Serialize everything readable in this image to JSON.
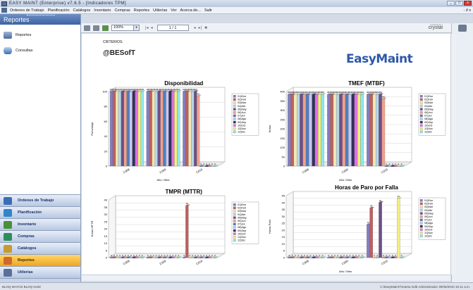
{
  "window": {
    "title": "EASY  MAINT (Enterprise) v7.6.5 - [Indicadores TPM]",
    "controls": [
      "_",
      "□",
      "x"
    ]
  },
  "menu": [
    "Ordenes de Trabajo",
    "Planificación",
    "Catálogos",
    "Inventario",
    "Compras",
    "Reportes",
    "Utilerías",
    "Ver",
    "Acerca de...",
    "Salir"
  ],
  "menu_right": "- ∂ x",
  "sidebar": {
    "header": "Reportes",
    "items": [
      {
        "label": "Reportes",
        "icon": "reports-icon"
      },
      {
        "label": "Consultas",
        "icon": "database-icon"
      }
    ],
    "nav": [
      {
        "label": "Ordenes de Trabajo",
        "icon": "work-orders-icon",
        "color": "#3b6db5"
      },
      {
        "label": "Planificación",
        "icon": "planning-icon",
        "color": "#2f86c9"
      },
      {
        "label": "Inventario",
        "icon": "inventory-icon",
        "color": "#4a8f3c"
      },
      {
        "label": "Compras",
        "icon": "cart-icon",
        "color": "#2c8e5f"
      },
      {
        "label": "Catálogos",
        "icon": "catalog-icon",
        "color": "#c99a2e"
      },
      {
        "label": "Reportes",
        "icon": "reports-icon",
        "color": "#d06a2c"
      },
      {
        "label": "Utilerías",
        "icon": "utilities-icon",
        "color": "#5a6f9a"
      }
    ]
  },
  "toolbar": {
    "zoom": "100%",
    "page": "1 / 1",
    "brand_small": "powered by",
    "brand": "crystal"
  },
  "report": {
    "criterios": "CRITERIOS:",
    "company": "@BESofT",
    "logo": "EasyMaint"
  },
  "status": {
    "left": "BLOQ MAYÚS  BLOQ NUM",
    "right": "C:\\EasyMaint7\\manto.mdb   Administrador   30/06/2010  10:11 a.m."
  },
  "legend": [
    "01)Ene",
    "02)Feb",
    "03)Mar",
    "04)Abr",
    "05)May",
    "06)Jun",
    "07)Jul",
    "08)Ago",
    "09)Sep",
    "10)Oct",
    "11)Nov",
    "12)Dic"
  ],
  "colors": [
    "#7f7fbf",
    "#bf5f5f",
    "#f2e6b3",
    "#b6d7e6",
    "#6c4f8a",
    "#f0a28a",
    "#4f7fbf",
    "#c8c8ee",
    "#30305f",
    "#e070e0",
    "#f2f07a",
    "#8ee8f0"
  ],
  "chart_data": [
    {
      "type": "bar",
      "title": "Disponibilidad",
      "categories": [
        "2,008",
        "2,009",
        "2,010"
      ],
      "xlabel": "Año / Mes",
      "ylabel": "Porcentaje",
      "ylim": [
        0,
        100
      ],
      "ticks": [
        0,
        20,
        40,
        60,
        80,
        100
      ],
      "series": [
        {
          "name": "01)Ene",
          "values": [
            100,
            100,
            100
          ]
        },
        {
          "name": "02)Feb",
          "values": [
            100,
            100,
            100
          ]
        },
        {
          "name": "03)Mar",
          "values": [
            100,
            100,
            100
          ]
        },
        {
          "name": "04)Abr",
          "values": [
            100,
            100,
            100
          ]
        },
        {
          "name": "05)May",
          "values": [
            100,
            100,
            100
          ]
        },
        {
          "name": "06)Jun",
          "values": [
            100,
            100,
            94
          ]
        },
        {
          "name": "07)Jul",
          "values": [
            100,
            100,
            0
          ]
        },
        {
          "name": "08)Ago",
          "values": [
            100,
            100,
            0
          ]
        },
        {
          "name": "09)Sep",
          "values": [
            100,
            100,
            0
          ]
        },
        {
          "name": "10)Oct",
          "values": [
            100,
            100,
            0
          ]
        },
        {
          "name": "11)Nov",
          "values": [
            100,
            100,
            0
          ]
        },
        {
          "name": "12)Dic",
          "values": [
            100,
            100,
            0
          ]
        }
      ]
    },
    {
      "type": "bar",
      "title": "TMEF (MTBF)",
      "categories": [
        "2,008",
        "2,009",
        "2,010"
      ],
      "xlabel": "Año / Mes",
      "ylabel": "Horas",
      "ylim": [
        0,
        400
      ],
      "ticks": [
        0,
        50,
        100,
        150,
        200,
        250,
        300,
        350,
        400
      ],
      "series": [
        {
          "name": "01)Ene",
          "values": [
            384,
            384,
            384
          ]
        },
        {
          "name": "02)Feb",
          "values": [
            384,
            384,
            384
          ]
        },
        {
          "name": "03)Mar",
          "values": [
            384,
            384,
            384
          ]
        },
        {
          "name": "04)Abr",
          "values": [
            384,
            384,
            384
          ]
        },
        {
          "name": "05)May",
          "values": [
            384,
            384,
            384
          ]
        },
        {
          "name": "06)Jun",
          "values": [
            384,
            384,
            360
          ]
        },
        {
          "name": "07)Jul",
          "values": [
            384,
            384,
            0
          ]
        },
        {
          "name": "08)Ago",
          "values": [
            384,
            384,
            0
          ]
        },
        {
          "name": "09)Sep",
          "values": [
            384,
            384,
            0
          ]
        },
        {
          "name": "10)Oct",
          "values": [
            384,
            384,
            0
          ]
        },
        {
          "name": "11)Nov",
          "values": [
            384,
            384,
            0
          ]
        },
        {
          "name": "12)Dic",
          "values": [
            384,
            384,
            0
          ]
        }
      ]
    },
    {
      "type": "bar",
      "title": "TMPR (MTTR)",
      "categories": [
        "2,008",
        "2,009",
        "2,010"
      ],
      "xlabel": "",
      "ylabel": "Horas MTTR",
      "ylim": [
        0,
        40
      ],
      "ticks": [
        0,
        5,
        10,
        15,
        20,
        25,
        30,
        35,
        40
      ],
      "series": [
        {
          "name": "01)Ene",
          "values": [
            0,
            0,
            0
          ]
        },
        {
          "name": "02)Feb",
          "values": [
            0,
            0,
            36
          ]
        },
        {
          "name": "03)Mar",
          "values": [
            0,
            0,
            0
          ]
        },
        {
          "name": "04)Abr",
          "values": [
            0,
            0,
            0
          ]
        },
        {
          "name": "05)May",
          "values": [
            0,
            0,
            0
          ]
        },
        {
          "name": "06)Jun",
          "values": [
            0,
            0,
            0
          ]
        },
        {
          "name": "07)Jul",
          "values": [
            0,
            0,
            0
          ]
        },
        {
          "name": "08)Ago",
          "values": [
            0,
            0,
            0
          ]
        },
        {
          "name": "09)Sep",
          "values": [
            0,
            0,
            0
          ]
        },
        {
          "name": "10)Oct",
          "values": [
            0,
            0,
            0
          ]
        },
        {
          "name": "11)Nov",
          "values": [
            0,
            0,
            0
          ]
        },
        {
          "name": "12)Dic",
          "values": [
            0,
            0,
            0
          ]
        }
      ]
    },
    {
      "type": "bar",
      "title": "Horas de Paro por Falla",
      "categories": [
        "2,008",
        "2,009",
        "2,010"
      ],
      "xlabel": "Año / Mes",
      "ylabel": "Horas Paro",
      "ylim": [
        0,
        45
      ],
      "ticks": [
        0,
        5,
        10,
        15,
        20,
        25,
        30,
        35,
        40,
        45
      ],
      "series": [
        {
          "name": "01)Ene",
          "values": [
            0,
            0,
            24
          ]
        },
        {
          "name": "02)Feb",
          "values": [
            0,
            0,
            36
          ]
        },
        {
          "name": "03)Mar",
          "values": [
            0,
            0,
            0
          ]
        },
        {
          "name": "04)Abr",
          "values": [
            0,
            0,
            0
          ]
        },
        {
          "name": "05)May",
          "values": [
            0,
            0,
            40
          ]
        },
        {
          "name": "06)Jun",
          "values": [
            0,
            0,
            0
          ]
        },
        {
          "name": "07)Jul",
          "values": [
            0,
            0,
            0
          ]
        },
        {
          "name": "08)Ago",
          "values": [
            0,
            0,
            0
          ]
        },
        {
          "name": "09)Sep",
          "values": [
            0,
            0,
            0
          ]
        },
        {
          "name": "10)Oct",
          "values": [
            0,
            0,
            0
          ]
        },
        {
          "name": "11)Nov",
          "values": [
            0,
            0,
            43
          ]
        },
        {
          "name": "12)Dic",
          "values": [
            0,
            0,
            0
          ]
        }
      ]
    }
  ]
}
